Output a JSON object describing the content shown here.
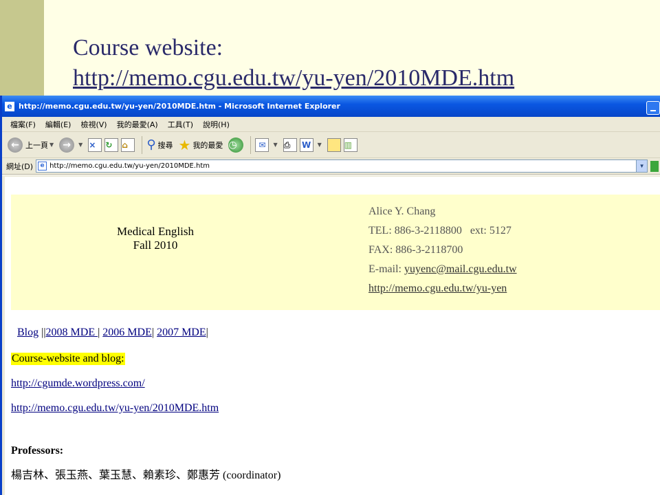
{
  "slide": {
    "title": "Course website:",
    "url": "http://memo.cgu.edu.tw/yu-yen/2010MDE.htm"
  },
  "browser": {
    "window_title": "http://memo.cgu.edu.tw/yu-yen/2010MDE.htm - Microsoft Internet Explorer",
    "menu": [
      "檔案(F)",
      "編輯(E)",
      "檢視(V)",
      "我的最愛(A)",
      "工具(T)",
      "說明(H)"
    ],
    "toolbar": {
      "back_label": "上一頁",
      "search_label": "搜尋",
      "favorites_label": "我的最愛"
    },
    "address_label": "網址(D)",
    "address_value": "http://memo.cgu.edu.tw/yu-yen/2010MDE.htm"
  },
  "page": {
    "course_title": "Medical English",
    "course_term": "Fall 2010",
    "contact": {
      "name": "Alice Y. Chang",
      "tel": "TEL: 886-3-2118800   ext: 5127",
      "fax": "FAX: 886-3-2118700",
      "email_prefix": "E-mail: ",
      "email": "yuyenc@mail.cgu.edu.tw",
      "homepage": "http://memo.cgu.edu.tw/yu-yen"
    },
    "nav": {
      "blog": "Blog",
      "sep1": " ||",
      "mde2008": "2008 MDE ",
      "sep2": "| ",
      "mde2006": "2006 MDE",
      "sep3": "| ",
      "mde2007": "2007 MDE",
      "sep4": "|"
    },
    "highlight": "Course-website and blog:",
    "link_blog": "http://cgumde.wordpress.com/",
    "link_site": "http://memo.cgu.edu.tw/yu-yen/2010MDE.htm",
    "professors_heading": "Professors:",
    "professors_list": "楊吉林、張玉燕、葉玉慧、賴素珍、鄭惠芳 (coordinator)"
  }
}
